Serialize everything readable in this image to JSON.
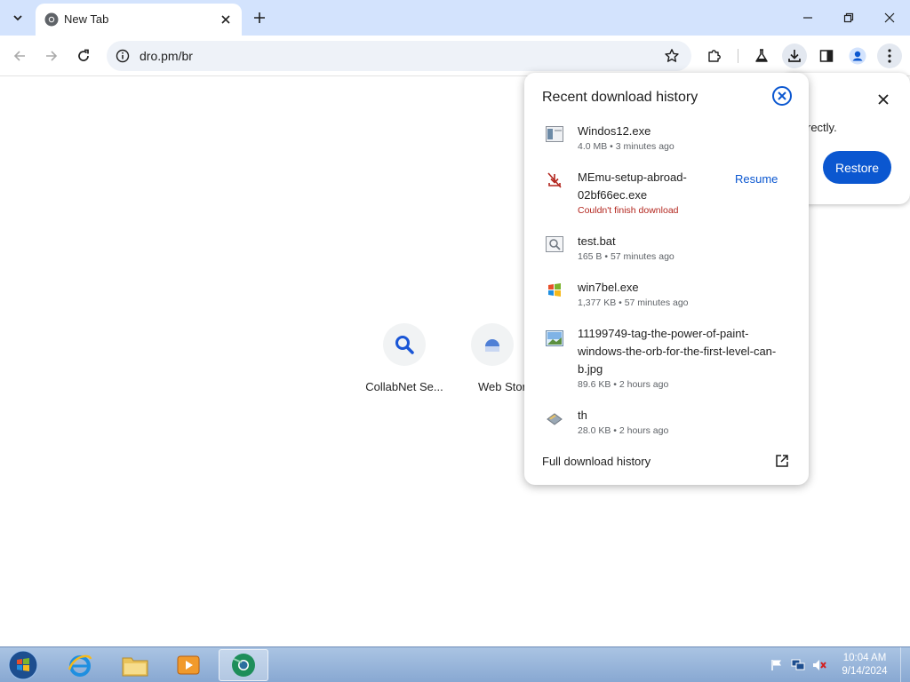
{
  "browser": {
    "tab": {
      "title": "New Tab",
      "favicon": "chrome-icon"
    },
    "url": "dro.pm/br",
    "window_buttons": [
      "minimize-icon",
      "restore-icon",
      "close-icon"
    ]
  },
  "shortcuts": [
    {
      "label": "CollabNet Se...",
      "icon": "search-icon"
    },
    {
      "label": "Web Stor",
      "icon": "webstore-icon"
    }
  ],
  "restore_bubble": {
    "text_fragment": "rectly.",
    "button_label": "Restore"
  },
  "downloads": {
    "title": "Recent download history",
    "items": [
      {
        "name": "Windos12.exe",
        "meta": "4.0 MB • 3 minutes ago",
        "icon": "exe-file-icon"
      },
      {
        "name": "MEmu-setup-abroad-02bf66ec.exe",
        "meta": "Couldn't finish download",
        "status": "error",
        "action": "Resume",
        "icon": "download-failed-icon"
      },
      {
        "name": "test.bat",
        "meta": "165 B • 57 minutes ago",
        "icon": "bat-file-icon"
      },
      {
        "name": "win7bel.exe",
        "meta": "1,377 KB • 57 minutes ago",
        "icon": "windows-logo-icon"
      },
      {
        "name": "11199749-tag-the-power-of-paint-windows-the-orb-for-the-first-level-can-b.jpg",
        "meta": "89.6 KB • 2 hours ago",
        "icon": "image-file-icon"
      },
      {
        "name": "th",
        "meta": "28.0 KB • 2 hours ago",
        "icon": "generic-file-icon"
      }
    ],
    "footer": "Full download history"
  },
  "taskbar": {
    "time": "10:04 AM",
    "date": "9/14/2024",
    "apps": [
      "internet-explorer-icon",
      "file-explorer-icon",
      "media-player-icon",
      "chrome-beta-icon"
    ]
  },
  "colors": {
    "tabstrip": "#d3e3fd",
    "accent": "#0b57d0",
    "error": "#b3261e",
    "taskbar": "#9db8dc"
  }
}
